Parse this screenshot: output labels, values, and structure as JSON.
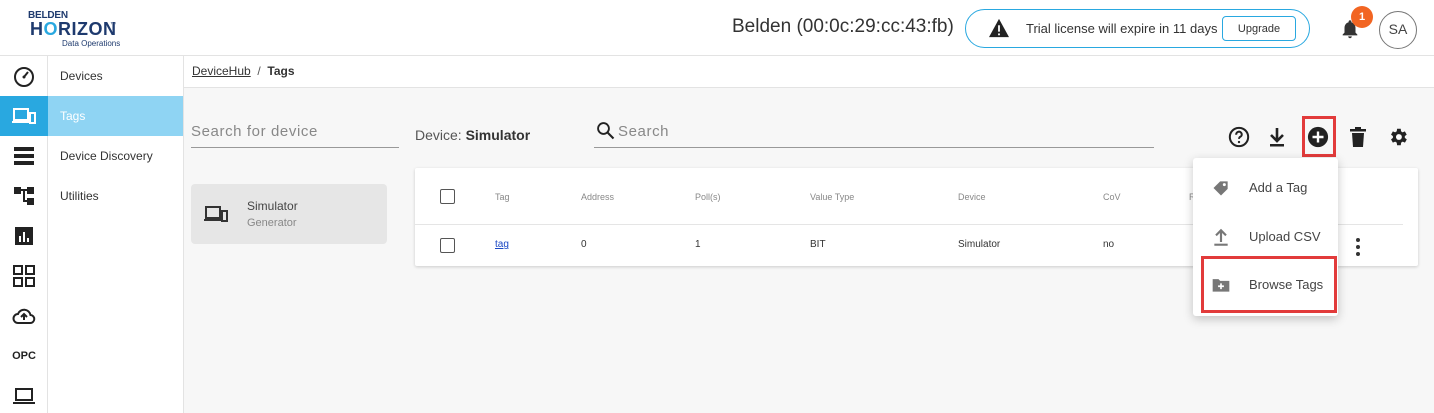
{
  "brand": {
    "line1": "BELDEN",
    "line2a": "H",
    "line2b": "O",
    "line2c": "RIZON",
    "tm": "™",
    "line3": "Data Operations"
  },
  "header": {
    "device_name": "Belden (00:0c:29:cc:43:fb)",
    "trial_message": "Trial license will expire in 11 days",
    "upgrade_label": "Upgrade",
    "notification_count": "1",
    "avatar_initials": "SA"
  },
  "rail": [
    {
      "icon": "dashboard-icon"
    },
    {
      "icon": "devices-icon",
      "active": true
    },
    {
      "icon": "storage-icon"
    },
    {
      "icon": "flow-icon"
    },
    {
      "icon": "analytics-icon"
    },
    {
      "icon": "apps-icon"
    },
    {
      "icon": "cloud-upload-icon"
    },
    {
      "icon": "opc-icon",
      "label": "OPC"
    },
    {
      "icon": "laptop-icon"
    }
  ],
  "nav": {
    "items": [
      {
        "label": "Devices"
      },
      {
        "label": "Tags",
        "active": true
      },
      {
        "label": "Device Discovery"
      },
      {
        "label": "Utilities"
      }
    ]
  },
  "breadcrumb": {
    "root": "DeviceHub",
    "sep": "/",
    "current": "Tags"
  },
  "device_panel": {
    "search_placeholder": "Search for device",
    "card": {
      "name": "Simulator",
      "type": "Generator"
    }
  },
  "main": {
    "device_label": "Device:",
    "device_value": "Simulator",
    "search_placeholder": "Search"
  },
  "table": {
    "headers": [
      "Tag",
      "Address",
      "Poll(s)",
      "Value Type",
      "Device",
      "CoV",
      "R"
    ],
    "rows": [
      {
        "tag": "tag",
        "address": "0",
        "poll": "1",
        "value_type": "BIT",
        "device": "Simulator",
        "cov": "no"
      }
    ]
  },
  "add_menu": {
    "items": [
      {
        "label": "Add a Tag",
        "icon": "tag-icon"
      },
      {
        "label": "Upload CSV",
        "icon": "upload-icon"
      },
      {
        "label": "Browse Tags",
        "icon": "folder-plus-icon"
      }
    ]
  },
  "colors": {
    "accent": "#29a8e0",
    "nav_active": "#8fd4f3",
    "highlight": "#e23b3b",
    "badge": "#f26522"
  }
}
